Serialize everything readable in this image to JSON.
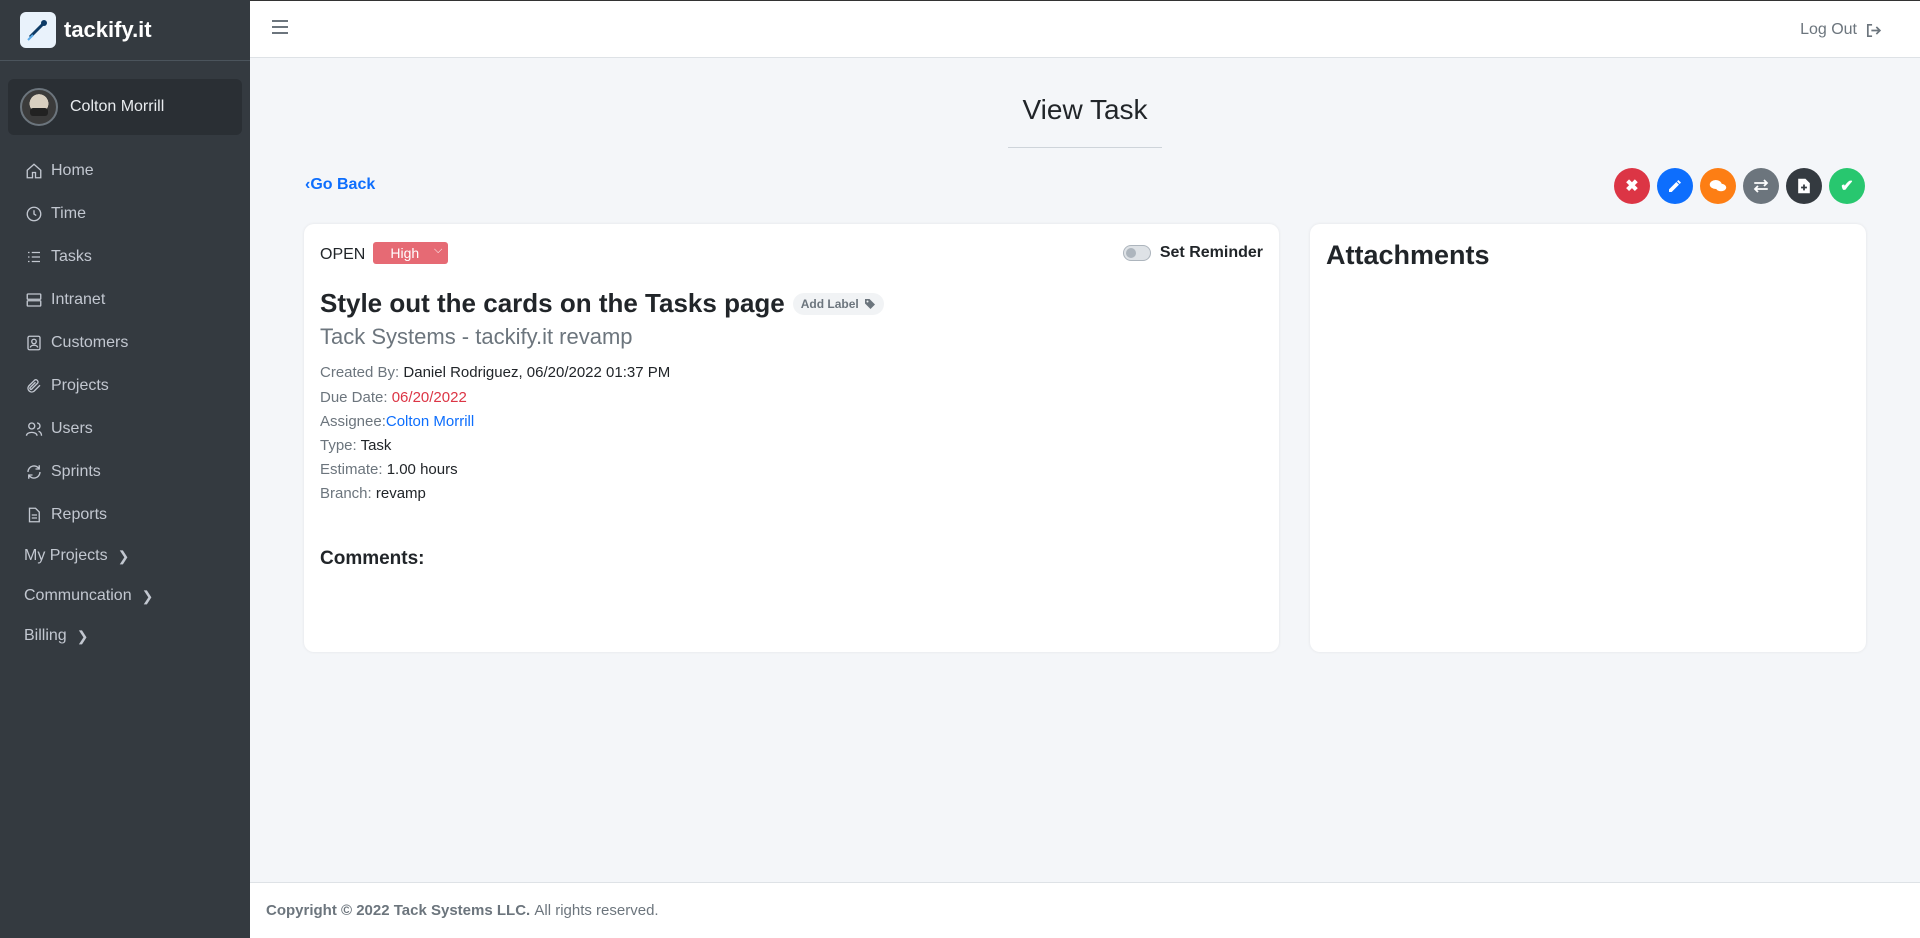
{
  "brand": {
    "name": "tackify.it"
  },
  "user": {
    "name": "Colton Morrill"
  },
  "sidebar": {
    "items": [
      {
        "label": "Home",
        "icon": "home-icon"
      },
      {
        "label": "Time",
        "icon": "clock-icon"
      },
      {
        "label": "Tasks",
        "icon": "list-icon"
      },
      {
        "label": "Intranet",
        "icon": "server-icon"
      },
      {
        "label": "Customers",
        "icon": "contact-icon"
      },
      {
        "label": "Projects",
        "icon": "paperclip-icon"
      },
      {
        "label": "Users",
        "icon": "users-icon"
      },
      {
        "label": "Sprints",
        "icon": "refresh-icon"
      },
      {
        "label": "Reports",
        "icon": "document-icon"
      }
    ],
    "groups": [
      {
        "label": "My Projects"
      },
      {
        "label": "Communcation"
      },
      {
        "label": "Billing"
      }
    ]
  },
  "header": {
    "logout_label": "Log Out"
  },
  "page": {
    "title": "View Task",
    "go_back": "Go Back"
  },
  "actions": [
    {
      "name": "delete",
      "color": "#dc3545",
      "icon": "x-icon"
    },
    {
      "name": "edit",
      "color": "#0d6efd",
      "icon": "pencil-icon"
    },
    {
      "name": "comment",
      "color": "#fd7e14",
      "icon": "chat-icon"
    },
    {
      "name": "transfer",
      "color": "#6c757d",
      "icon": "arrows-icon"
    },
    {
      "name": "file",
      "color": "#343a40",
      "icon": "file-plus-icon"
    },
    {
      "name": "complete",
      "color": "#28c76f",
      "icon": "check-icon"
    }
  ],
  "task": {
    "status": "OPEN",
    "priority": "High",
    "reminder_label": "Set Reminder",
    "title": "Style out the cards on the Tasks page",
    "add_label": "Add Label",
    "subtitle": "Tack Systems - tackify.it revamp",
    "created_by_label": "Created By:",
    "created_by": "Daniel Rodriguez, 06/20/2022 01:37 PM",
    "due_date_label": "Due Date:",
    "due_date": "06/20/2022",
    "assignee_label": "Assignee:",
    "assignee": "Colton Morrill",
    "type_label": "Type:",
    "type": "Task",
    "estimate_label": "Estimate:",
    "estimate": "1.00 hours",
    "branch_label": "Branch:",
    "branch": "revamp",
    "comments_label": "Comments:"
  },
  "attachments": {
    "title": "Attachments"
  },
  "footer": {
    "copyright": "Copyright © 2022 Tack Systems LLC.",
    "rights": "All rights reserved."
  }
}
